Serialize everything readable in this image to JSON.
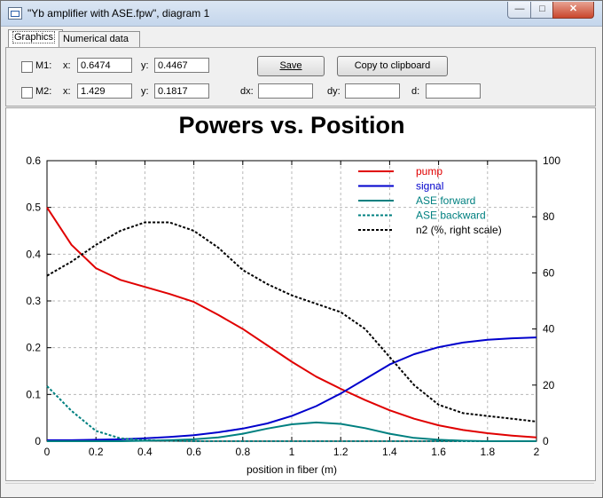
{
  "window": {
    "title": "\"Yb amplifier with ASE.fpw\", diagram 1"
  },
  "tabs": [
    {
      "label": "Graphics",
      "active": true
    },
    {
      "label": "Numerical data",
      "active": false
    }
  ],
  "markers": {
    "m1": {
      "label": "M1:",
      "x_label": "x:",
      "x_value": "0.6474",
      "y_label": "y:",
      "y_value": "0.4467"
    },
    "m2": {
      "label": "M2:",
      "x_label": "x:",
      "x_value": "1.429",
      "y_label": "y:",
      "y_value": "0.1817",
      "dx_label": "dx:",
      "dx_value": "",
      "dy_label": "dy:",
      "dy_value": "",
      "d_label": "d:",
      "d_value": ""
    }
  },
  "buttons": {
    "save_label": "Save",
    "copy_label": "Copy to clipboard"
  },
  "chart_data": {
    "type": "line",
    "title": "Powers vs. Position",
    "xlabel": "position in fiber (m)",
    "ylabel": "",
    "xlim": [
      0,
      2
    ],
    "ylim": [
      0,
      0.6
    ],
    "y2lim": [
      0,
      100
    ],
    "xticks": [
      "0",
      "0.2",
      "0.4",
      "0.6",
      "0.8",
      "1",
      "1.2",
      "1.4",
      "1.6",
      "1.8",
      "2"
    ],
    "yticks": [
      "0",
      "0.1",
      "0.2",
      "0.3",
      "0.4",
      "0.5",
      "0.6"
    ],
    "y2ticks": [
      "0",
      "20",
      "40",
      "60",
      "80",
      "100"
    ],
    "grid": true,
    "legend_position": "top-right",
    "x": [
      0,
      0.1,
      0.2,
      0.3,
      0.4,
      0.5,
      0.6,
      0.7,
      0.8,
      0.9,
      1.0,
      1.1,
      1.2,
      1.3,
      1.4,
      1.5,
      1.6,
      1.7,
      1.8,
      1.9,
      2.0
    ],
    "series": [
      {
        "name": "pump",
        "color": "#e00000",
        "dash": false,
        "axis": "left",
        "values": [
          0.5,
          0.42,
          0.37,
          0.345,
          0.33,
          0.315,
          0.298,
          0.27,
          0.24,
          0.205,
          0.17,
          0.138,
          0.112,
          0.088,
          0.066,
          0.048,
          0.034,
          0.024,
          0.017,
          0.012,
          0.008
        ]
      },
      {
        "name": "signal",
        "color": "#0000cc",
        "dash": false,
        "axis": "left",
        "values": [
          0.002,
          0.002,
          0.003,
          0.004,
          0.006,
          0.009,
          0.013,
          0.019,
          0.027,
          0.038,
          0.054,
          0.075,
          0.102,
          0.133,
          0.164,
          0.186,
          0.201,
          0.211,
          0.217,
          0.22,
          0.222
        ]
      },
      {
        "name": "ASE forward",
        "color": "#008080",
        "dash": false,
        "axis": "left",
        "values": [
          0,
          0,
          0,
          0,
          0.001,
          0.002,
          0.004,
          0.008,
          0.016,
          0.027,
          0.036,
          0.04,
          0.037,
          0.028,
          0.016,
          0.007,
          0.003,
          0.001,
          0,
          0,
          0
        ]
      },
      {
        "name": "ASE backward",
        "color": "#008080",
        "dash": true,
        "axis": "left",
        "values": [
          0.118,
          0.065,
          0.022,
          0.006,
          0.002,
          0.001,
          0,
          0,
          0,
          0,
          0,
          0,
          0,
          0,
          0,
          0,
          0,
          0,
          0,
          0,
          0
        ]
      },
      {
        "name": "n2 (%, right scale)",
        "color": "#000000",
        "dash": true,
        "axis": "right",
        "values": [
          59,
          64,
          70,
          75,
          78,
          78,
          75,
          69,
          61,
          56,
          52,
          49,
          46,
          40,
          30,
          20,
          13,
          10,
          9,
          8,
          7
        ]
      }
    ]
  }
}
